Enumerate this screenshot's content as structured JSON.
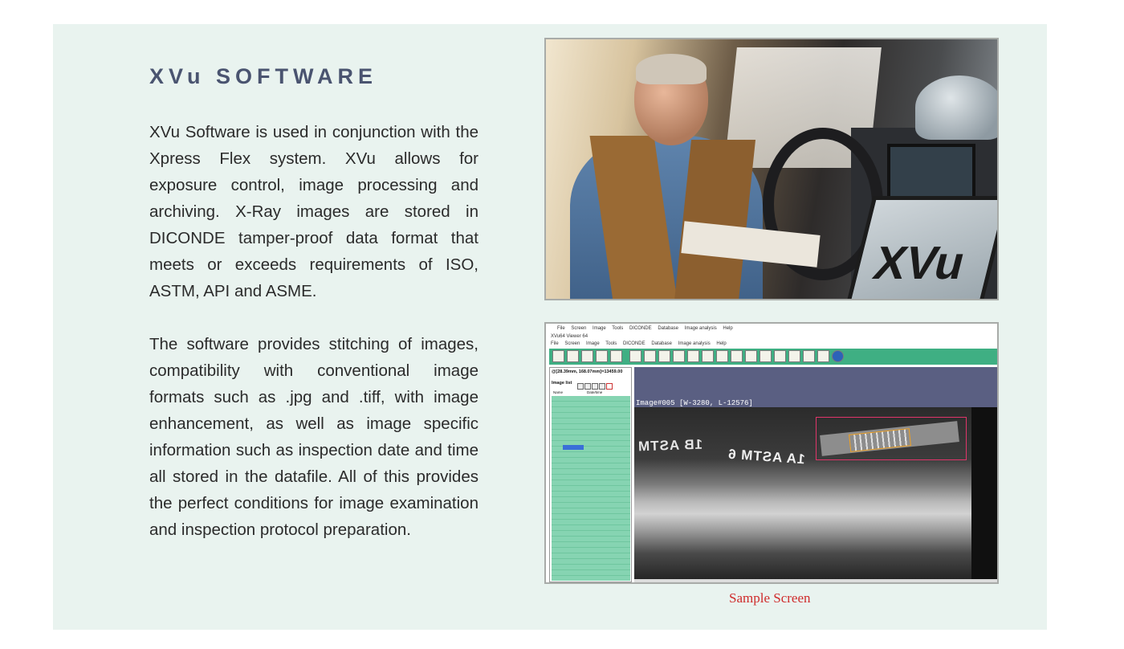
{
  "heading": "XVu SOFTWARE",
  "paragraphs": [
    "XVu Software is used in conjunction with the Xpress Flex system. XVu allows for exposure control, image processing and archiving. X-Ray images are stored in DICONDE tamper-proof data format that meets or exceeds requirements of ISO, ASTM, API and ASME.",
    "The software provides stitching of images, compatibility with conventional image formats such as .jpg and .tiff, with image enhancement, as well as image specific information such as inspection date and time all stored in the datafile. All of this provides the perfect conditions for image examination and inspection protocol preparation."
  ],
  "photo": {
    "laptop_logo": "XVu"
  },
  "sample_screen": {
    "top_menu": [
      "File",
      "Screen",
      "Image",
      "Tools",
      "DICONDE",
      "Database",
      "Image analysis",
      "Help"
    ],
    "window_title": "XVu64 Viewer 64",
    "menu": [
      "File",
      "Screen",
      "Image",
      "Tools",
      "DICONDE",
      "Database",
      "Image analysis",
      "Help"
    ],
    "coordinates": "@[28.39mm, 168.07mm]=13459.00",
    "image_list_label": "Image list",
    "columns": [
      "Name",
      "Date/time"
    ],
    "image_label": "Image#005 [W-3280, L-12576]",
    "marker_left": "1B ASTM",
    "marker_center": "1A ASTM 6"
  },
  "caption": "Sample Screen"
}
